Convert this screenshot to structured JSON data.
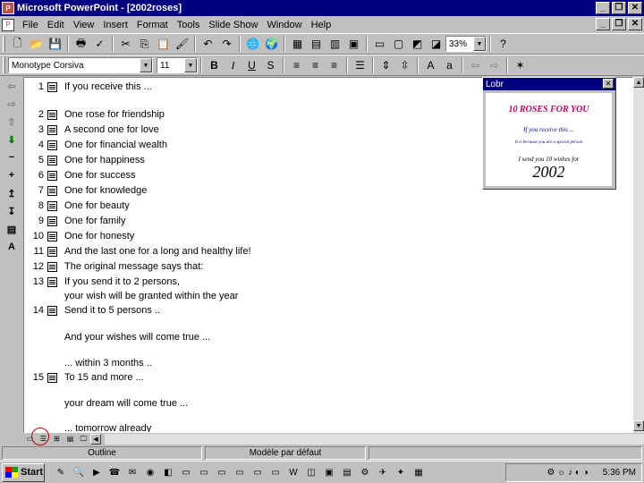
{
  "window": {
    "title": "Microsoft PowerPoint - [2002roses]"
  },
  "menu": [
    "File",
    "Edit",
    "View",
    "Insert",
    "Format",
    "Tools",
    "Slide Show",
    "Window",
    "Help"
  ],
  "toolbar": {
    "zoom": "33%"
  },
  "format": {
    "font": "Monotype Corsiva",
    "size": "11"
  },
  "slides": [
    {
      "n": "1",
      "text": "If you receive this ..."
    },
    {
      "n": "2",
      "text": "One rose for friendship"
    },
    {
      "n": "3",
      "text": "A second one for love"
    },
    {
      "n": "4",
      "text": "One for financial wealth"
    },
    {
      "n": "5",
      "text": "One for happiness"
    },
    {
      "n": "6",
      "text": "One for success"
    },
    {
      "n": "7",
      "text": "One for knowledge"
    },
    {
      "n": "8",
      "text": "One for beauty"
    },
    {
      "n": "9",
      "text": "One for family"
    },
    {
      "n": "10",
      "text": "One for honesty"
    },
    {
      "n": "11",
      "text": "And the last one for a long and healthy life!"
    },
    {
      "n": "12",
      "text": "The original message says that:"
    },
    {
      "n": "13",
      "text": "If you send it to 2 persons,"
    },
    {
      "n": "14",
      "text": "Send it to 5 persons .."
    },
    {
      "n": "15",
      "text": "To 15 and more ..."
    }
  ],
  "sublines": {
    "s13": "your wish will be granted within the year",
    "s14a": "And your wishes will come true ...",
    "s14b": "... within 3 months ..",
    "s15a": "your dream will come true ...",
    "s15b": "... tomorrow already"
  },
  "preview": {
    "title": "Lobr",
    "line1": "10 ROSES FOR YOU",
    "line2": "If you receive this ...",
    "line3": "It is because you are a special person",
    "line4": "I send you 10 wishes for",
    "year": "2002"
  },
  "status": {
    "view": "Outline",
    "design": "Modèle par défaut"
  },
  "taskbar": {
    "start": "Start",
    "clock": "5:36 PM"
  }
}
